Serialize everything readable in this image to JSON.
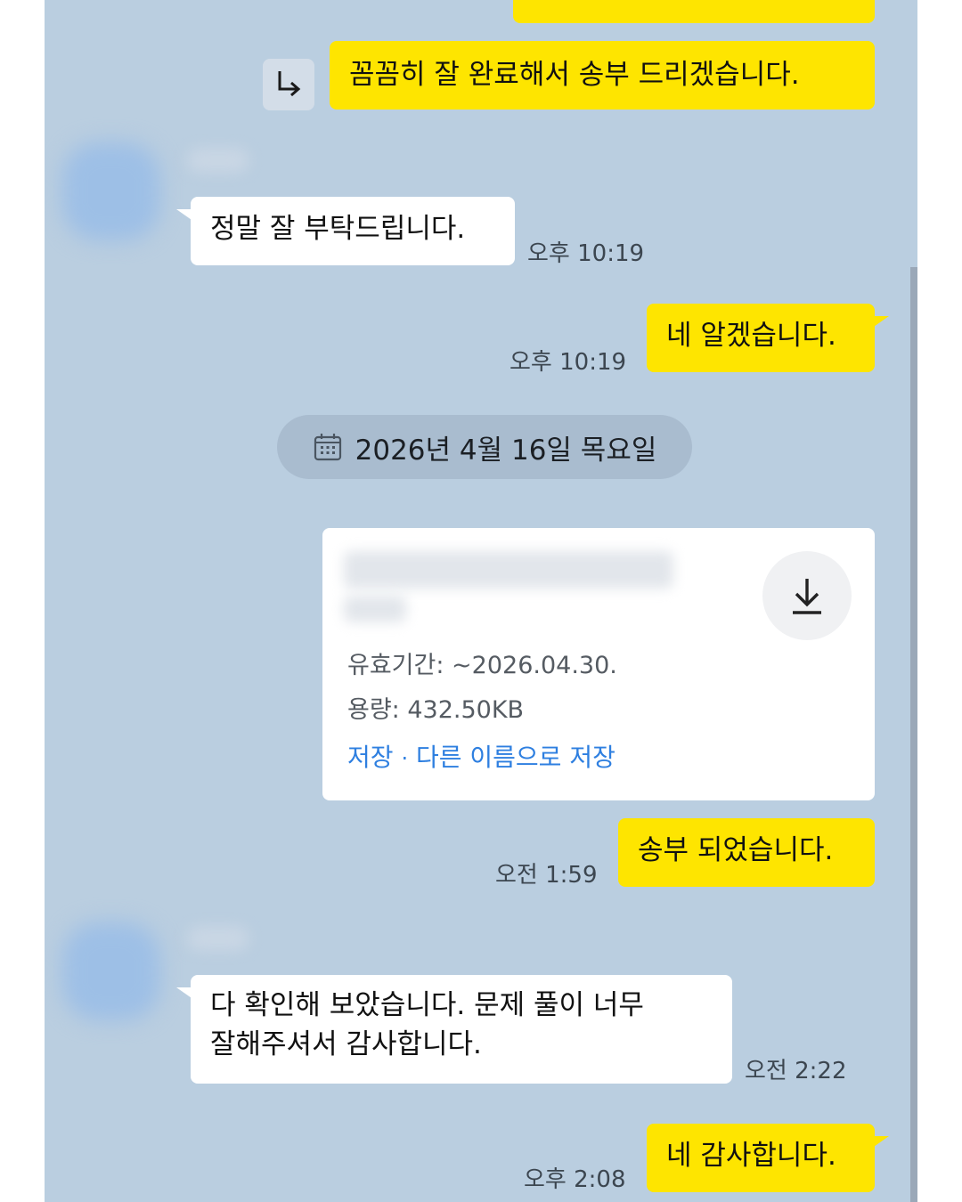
{
  "messages": {
    "m1": {
      "text": "꼼꼼히 잘 완료해서 송부 드리겠습니다."
    },
    "m2": {
      "text": "정말 잘 부탁드립니다.",
      "time": "오후 10:19"
    },
    "m3": {
      "text": "네 알겠습니다.",
      "time": "오후 10:19"
    },
    "m4": {
      "text": "송부 되었습니다.",
      "time": "오전 1:59"
    },
    "m5": {
      "line1": "다 확인해 보았습니다. 문제 풀이 너무",
      "line2": "잘해주셔서 감사합니다.",
      "time": "오전 2:22"
    },
    "m6": {
      "text": "네 감사합니다.",
      "time": "오후 2:08"
    }
  },
  "date_divider": {
    "text": "2026년 4월 16일 목요일",
    "icon": "calendar-icon"
  },
  "file": {
    "validity": "유효기간: ~2026.04.30.",
    "size": "용량: 432.50KB",
    "save_label": "저장",
    "separator": "·",
    "save_as_label": "다른 이름으로 저장",
    "icon": "download-icon"
  },
  "reply_icon": "reply-arrow-icon",
  "colors": {
    "background": "#bacee0",
    "my_bubble": "#fee500",
    "their_bubble": "#ffffff",
    "link": "#2e7fe0"
  }
}
